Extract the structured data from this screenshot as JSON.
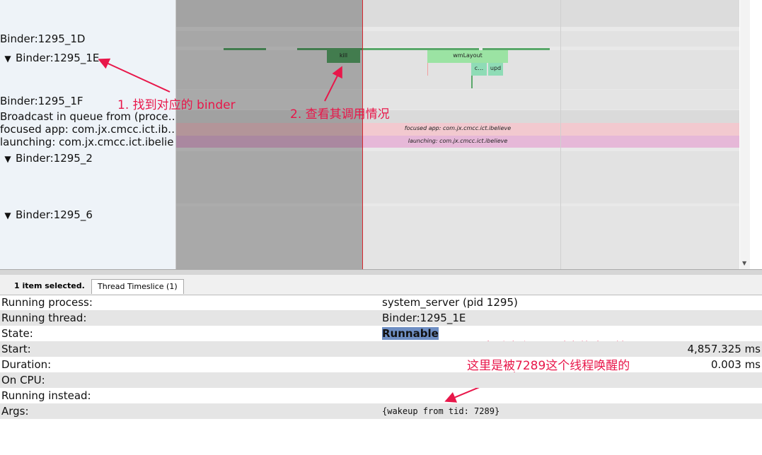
{
  "tracks": {
    "t1d": "Binder:1295_1D",
    "t1e": "Binder:1295_1E",
    "t1f": "Binder:1295_1F",
    "broadcast": "Broadcast in queue from (proce…",
    "focused": "focused app: com.jx.cmcc.ict.ib…",
    "launching": "launching: com.jx.cmcc.ict.ibelie…",
    "t2": "Binder:1295_2",
    "t6": "Binder:1295_6",
    "expand_icon": "▼"
  },
  "slices": {
    "kill": "kill",
    "wmlayout": "wmLayout",
    "c": "c…",
    "upd": "upd",
    "focused_slice": "focused app: com.jx.cmcc.ict.ibelieve",
    "launching_slice": "launching: com.jx.cmcc.ict.ibelieve"
  },
  "colors": {
    "slice_green": "#7fcf8f",
    "slice_dark_green": "#5aa86a",
    "focused_band": "#f2c9cf",
    "launching_band": "#e6b8d8",
    "cursor_line": "#d7262e",
    "annotation": "#e8174a",
    "runnable_highlight": "#6f8fc4"
  },
  "tabs": {
    "selected_count": "1 item selected.",
    "thread_timeslice": "Thread Timeslice (1)"
  },
  "details": [
    {
      "label": "Running process:",
      "value": "system_server (pid 1295)",
      "value2": ""
    },
    {
      "label": "Running thread:",
      "value": "Binder:1295_1E",
      "value2": ""
    },
    {
      "label": "State:",
      "value": "Runnable",
      "value2": ""
    },
    {
      "label": "Start:",
      "value": "",
      "value2": "4,857.325 ms"
    },
    {
      "label": "Duration:",
      "value": "",
      "value2": "0.003 ms"
    },
    {
      "label": "On CPU:",
      "value": "",
      "value2": ""
    },
    {
      "label": "Running instead:",
      "value": "",
      "value2": ""
    },
    {
      "label": "Args:",
      "value": "{wakeup from tid: 7289}",
      "value2": ""
    }
  ],
  "annotations": {
    "a1": "1. 找到对应的 binder",
    "a2": "2. 查看其调用情况",
    "a3_line1": "3. 查看这个 kill 对应的唤醒情况",
    "a3_line2": "这里是被7289这个线程唤醒的"
  }
}
